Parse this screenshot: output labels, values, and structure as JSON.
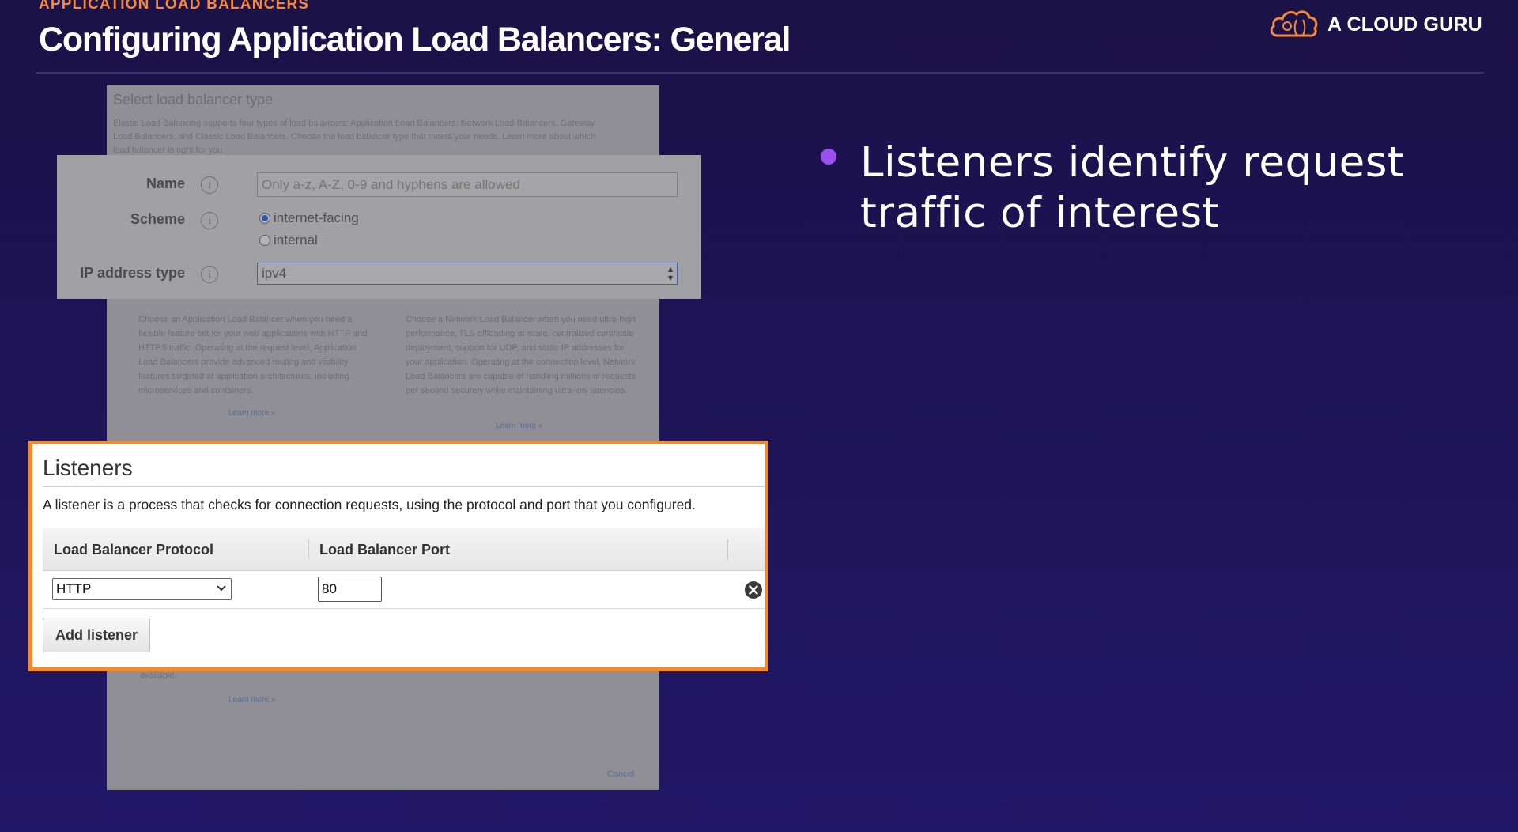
{
  "header": {
    "eyebrow": "APPLICATION LOAD BALANCERS",
    "title": "Configuring Application Load Balancers: General",
    "logo_text": "A CLOUD GURU"
  },
  "background_panel": {
    "title": "Select load balancer type",
    "description": "Elastic Load Balancing supports four types of load balancers: Application Load Balancers, Network Load Balancers, Gateway Load Balancers, and Classic Load Balancers. Choose the load balancer type that meets your needs. Learn more about which load balancer is right for you",
    "alb_description": "Choose an Application Load Balancer when you need a flexible feature set for your web applications with HTTP and HTTPS traffic. Operating at the request level, Application Load Balancers provide advanced routing and visibility features targeted at application architectures, including microservices and containers.",
    "nlb_description": "Choose a Network Load Balancer when you need ultra-high performance, TLS offloading at scale, centralized certificate deployment, support for UDP, and static IP addresses for your application. Operating at the connection level, Network Load Balancers are capable of handling millions of requests per second securely while maintaining ultra-low latencies.",
    "learn_more": "Learn more »",
    "small_text": "available.",
    "footer_link": "Cancel"
  },
  "basic_config": {
    "name_label": "Name",
    "name_placeholder": "Only a-z, A-Z, 0-9 and hyphens are allowed",
    "scheme_label": "Scheme",
    "scheme_options": [
      "internet-facing",
      "internal"
    ],
    "scheme_selected": "internet-facing",
    "ip_label": "IP address type",
    "ip_value": "ipv4",
    "info_glyph": "i"
  },
  "listeners": {
    "title": "Listeners",
    "description": "A listener is a process that checks for connection requests, using the protocol and port that you configured.",
    "columns": [
      "Load Balancer Protocol",
      "Load Balancer Port"
    ],
    "rows": [
      {
        "protocol": "HTTP",
        "port": "80"
      }
    ],
    "add_button": "Add listener"
  },
  "bullets": [
    "Listeners identify request traffic of interest"
  ],
  "colors": {
    "background": "#1e1356",
    "accent_orange": "#f7893b",
    "listener_border": "#f08a2c",
    "bullet": "#9a4ff0"
  },
  "icons": {
    "logo": "cloud-logo-icon",
    "info": "info-icon",
    "remove": "remove-circle-icon",
    "select_arrow": "chevron-down-icon"
  }
}
